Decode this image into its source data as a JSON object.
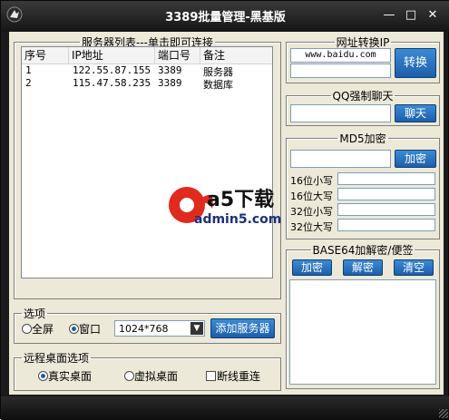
{
  "window": {
    "title": "3389批量管理-黑基版"
  },
  "server_list": {
    "group_title": "服务器列表---单击即可连接",
    "columns": [
      "序号",
      "IP地址",
      "端口号",
      "备注"
    ],
    "rows": [
      {
        "index": "1",
        "ip": "122.55.87.155",
        "port": "3389",
        "note": "服务器"
      },
      {
        "index": "2",
        "ip": "115.47.58.235",
        "port": "3389",
        "note": "数据库"
      }
    ]
  },
  "options": {
    "group_title": "选项",
    "fullscreen_label": "全屏",
    "window_label": "窗口",
    "selected_mode": "窗口",
    "resolution": "1024*768",
    "add_server_label": "添加服务器"
  },
  "remote_desktop": {
    "group_title": "远程桌面选项",
    "real_label": "真实桌面",
    "virtual_label": "虚拟桌面",
    "reconnect_label": "断线重连",
    "selected": "真实桌面",
    "reconnect_checked": false
  },
  "url_to_ip": {
    "group_title": "网址转换IP",
    "url_value": "www.baidu.com",
    "ip_value": "",
    "convert_label": "转换"
  },
  "qq_chat": {
    "group_title": "QQ强制聊天",
    "input_value": "",
    "chat_label": "聊天"
  },
  "md5": {
    "group_title": "MD5加密",
    "input_value": "",
    "encrypt_label": "加密",
    "rows": [
      "16位小写",
      "16位大写",
      "32位小写",
      "32位大写"
    ]
  },
  "base64": {
    "group_title": "BASE64加解密/便签",
    "encrypt_label": "加密",
    "decrypt_label": "解密",
    "clear_label": "清空"
  },
  "watermark": {
    "brand": "a5下载",
    "domain": "admin5.com"
  },
  "colors": {
    "button": "#2a74c2",
    "titlebar": "#1b1b1b",
    "panel": "#ece9d8"
  }
}
